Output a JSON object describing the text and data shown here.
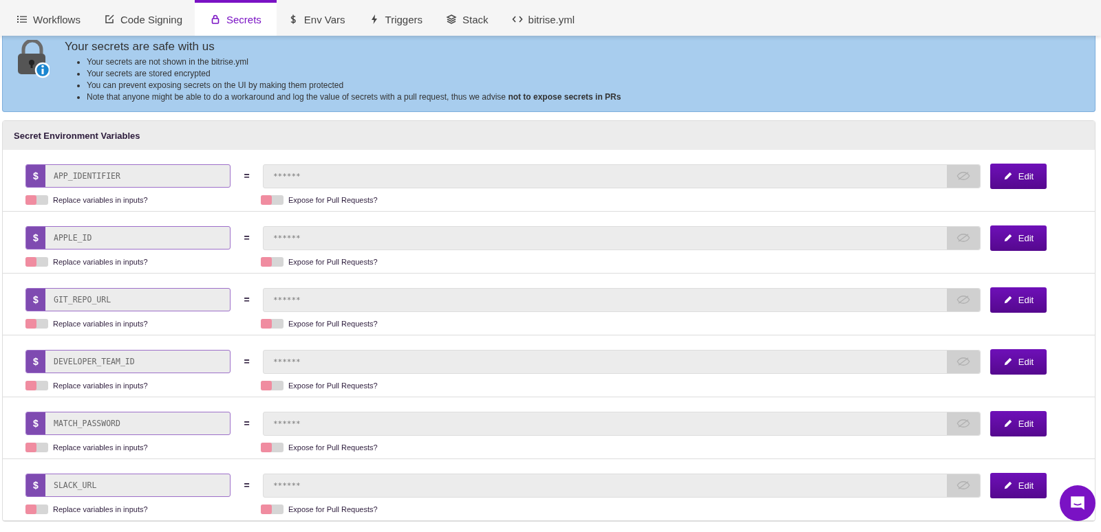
{
  "tabs": [
    {
      "label": "Workflows",
      "selected": false
    },
    {
      "label": "Code Signing",
      "selected": false
    },
    {
      "label": "Secrets",
      "selected": true
    },
    {
      "label": "Env Vars",
      "selected": false
    },
    {
      "label": "Triggers",
      "selected": false
    },
    {
      "label": "Stack",
      "selected": false
    },
    {
      "label": "bitrise.yml",
      "selected": false
    }
  ],
  "banner": {
    "title": "Your secrets are safe with us",
    "items": [
      "Your secrets are not shown in the bitrise.yml",
      "Your secrets are stored encrypted",
      "You can prevent exposing secrets on the UI by making them protected",
      "Note that anyone might be able to do a workaround and log the value of secrets with a pull request, thus we advise **not to expose secrets in PRs**"
    ]
  },
  "section": {
    "title": "Secret Environment Variables",
    "rows": [
      {
        "key": "APP_IDENTIFIER",
        "value": "******",
        "replace": {
          "label": "Replace variables in inputs?",
          "on": false
        },
        "expose": {
          "label": "Expose for Pull Requests?",
          "on": false
        },
        "edit": "Edit"
      },
      {
        "key": "APPLE_ID",
        "value": "******",
        "replace": {
          "label": "Replace variables in inputs?",
          "on": false
        },
        "expose": {
          "label": "Expose for Pull Requests?",
          "on": false
        },
        "edit": "Edit"
      },
      {
        "key": "GIT_REPO_URL",
        "value": "******",
        "replace": {
          "label": "Replace variables in inputs?",
          "on": false
        },
        "expose": {
          "label": "Expose for Pull Requests?",
          "on": false
        },
        "edit": "Edit"
      },
      {
        "key": "DEVELOPER_TEAM_ID",
        "value": "******",
        "replace": {
          "label": "Replace variables in inputs?",
          "on": false
        },
        "expose": {
          "label": "Expose for Pull Requests?",
          "on": false
        },
        "edit": "Edit"
      },
      {
        "key": "MATCH_PASSWORD",
        "value": "******",
        "replace": {
          "label": "Replace variables in inputs?",
          "on": false
        },
        "expose": {
          "label": "Expose for Pull Requests?",
          "on": false
        },
        "edit": "Edit"
      },
      {
        "key": "SLACK_URL",
        "value": "******",
        "replace": {
          "label": "Replace variables in inputs?",
          "on": false
        },
        "expose": {
          "label": "Expose for Pull Requests?",
          "on": false
        },
        "edit": "Edit"
      }
    ]
  },
  "dollar": "$",
  "equals": "="
}
